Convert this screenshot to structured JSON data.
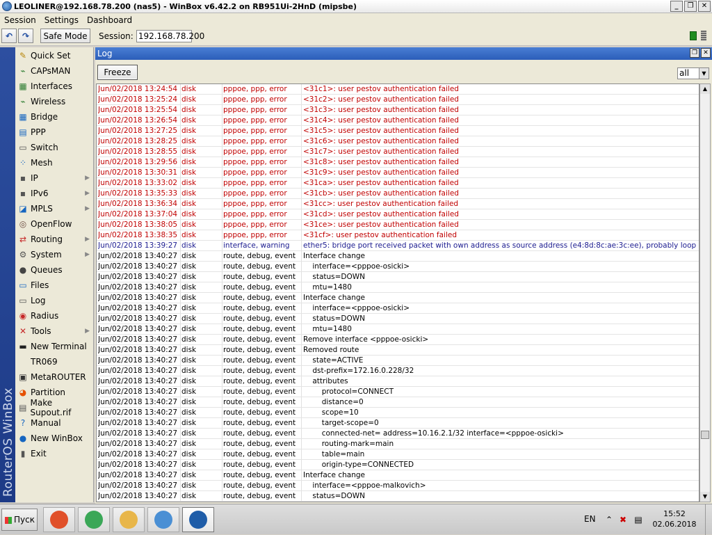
{
  "window": {
    "title": "LEOLINER@192.168.78.200 (nas5) - WinBox v6.42.2 on RB951Ui-2HnD (mipsbe)",
    "minimize": "_",
    "maximize": "❐",
    "close": "✕"
  },
  "menu": {
    "items": [
      "Session",
      "Settings",
      "Dashboard"
    ]
  },
  "toolbar": {
    "undo": "↶",
    "redo": "↷",
    "safe_mode": "Safe Mode",
    "session_label": "Session:",
    "session_value": "192.168.78.200"
  },
  "brand": "RouterOS WinBox",
  "sidebar": {
    "items": [
      {
        "label": "Quick Set",
        "icon": "quickset-icon",
        "glyph": "✎",
        "color": "#b8860b",
        "submenu": false
      },
      {
        "label": "CAPsMAN",
        "icon": "capsman-icon",
        "glyph": "⌁",
        "color": "#2e7d32",
        "submenu": false
      },
      {
        "label": "Interfaces",
        "icon": "interfaces-icon",
        "glyph": "▦",
        "color": "#2e7d32",
        "submenu": false
      },
      {
        "label": "Wireless",
        "icon": "wireless-icon",
        "glyph": "⌁",
        "color": "#2e7d32",
        "submenu": false
      },
      {
        "label": "Bridge",
        "icon": "bridge-icon",
        "glyph": "▦",
        "color": "#1565c0",
        "submenu": false
      },
      {
        "label": "PPP",
        "icon": "ppp-icon",
        "glyph": "▤",
        "color": "#1565c0",
        "submenu": false
      },
      {
        "label": "Switch",
        "icon": "switch-icon",
        "glyph": "▭",
        "color": "#555555",
        "submenu": false
      },
      {
        "label": "Mesh",
        "icon": "mesh-icon",
        "glyph": "⁘",
        "color": "#1565c0",
        "submenu": false
      },
      {
        "label": "IP",
        "icon": "ip-icon",
        "glyph": "▪",
        "color": "#555555",
        "submenu": true
      },
      {
        "label": "IPv6",
        "icon": "ipv6-icon",
        "glyph": "▪",
        "color": "#555555",
        "submenu": true
      },
      {
        "label": "MPLS",
        "icon": "mpls-icon",
        "glyph": "◪",
        "color": "#1565c0",
        "submenu": true
      },
      {
        "label": "OpenFlow",
        "icon": "openflow-icon",
        "glyph": "◎",
        "color": "#6d4c41",
        "submenu": false
      },
      {
        "label": "Routing",
        "icon": "routing-icon",
        "glyph": "⇄",
        "color": "#c62828",
        "submenu": true
      },
      {
        "label": "System",
        "icon": "system-icon",
        "glyph": "⚙",
        "color": "#555555",
        "submenu": true
      },
      {
        "label": "Queues",
        "icon": "queues-icon",
        "glyph": "●",
        "color": "#444444",
        "submenu": false
      },
      {
        "label": "Files",
        "icon": "files-icon",
        "glyph": "▭",
        "color": "#1565c0",
        "submenu": false
      },
      {
        "label": "Log",
        "icon": "log-icon",
        "glyph": "▭",
        "color": "#555555",
        "submenu": false
      },
      {
        "label": "Radius",
        "icon": "radius-icon",
        "glyph": "◉",
        "color": "#c62828",
        "submenu": false
      },
      {
        "label": "Tools",
        "icon": "tools-icon",
        "glyph": "✕",
        "color": "#c62828",
        "submenu": true
      },
      {
        "label": "New Terminal",
        "icon": "terminal-icon",
        "glyph": "▬",
        "color": "#222222",
        "submenu": false
      },
      {
        "label": "TR069",
        "icon": "",
        "glyph": "",
        "color": "#000000",
        "submenu": false
      },
      {
        "label": "MetaROUTER",
        "icon": "metarouter-icon",
        "glyph": "▣",
        "color": "#333333",
        "submenu": false
      },
      {
        "label": "Partition",
        "icon": "partition-icon",
        "glyph": "◕",
        "color": "#e65100",
        "submenu": false
      },
      {
        "label": "Make Supout.rif",
        "icon": "supout-icon",
        "glyph": "▤",
        "color": "#555555",
        "submenu": false
      },
      {
        "label": "Manual",
        "icon": "manual-icon",
        "glyph": "?",
        "color": "#1565c0",
        "submenu": false
      },
      {
        "label": "New WinBox",
        "icon": "winbox-icon",
        "glyph": "●",
        "color": "#1565c0",
        "submenu": false
      },
      {
        "label": "Exit",
        "icon": "exit-icon",
        "glyph": "▮",
        "color": "#555555",
        "submenu": false
      }
    ]
  },
  "log_window": {
    "title": "Log",
    "freeze_label": "Freeze",
    "filter_value": "all",
    "rows": [
      {
        "time": "Jun/02/2018 13:24:54",
        "buffer": "disk",
        "topics": "pppoe, ppp, error",
        "message": "<31c1>: user pestov authentication failed",
        "level": "error"
      },
      {
        "time": "Jun/02/2018 13:25:24",
        "buffer": "disk",
        "topics": "pppoe, ppp, error",
        "message": "<31c2>: user pestov authentication failed",
        "level": "error"
      },
      {
        "time": "Jun/02/2018 13:25:54",
        "buffer": "disk",
        "topics": "pppoe, ppp, error",
        "message": "<31c3>: user pestov authentication failed",
        "level": "error"
      },
      {
        "time": "Jun/02/2018 13:26:54",
        "buffer": "disk",
        "topics": "pppoe, ppp, error",
        "message": "<31c4>: user pestov authentication failed",
        "level": "error"
      },
      {
        "time": "Jun/02/2018 13:27:25",
        "buffer": "disk",
        "topics": "pppoe, ppp, error",
        "message": "<31c5>: user pestov authentication failed",
        "level": "error"
      },
      {
        "time": "Jun/02/2018 13:28:25",
        "buffer": "disk",
        "topics": "pppoe, ppp, error",
        "message": "<31c6>: user pestov authentication failed",
        "level": "error"
      },
      {
        "time": "Jun/02/2018 13:28:55",
        "buffer": "disk",
        "topics": "pppoe, ppp, error",
        "message": "<31c7>: user pestov authentication failed",
        "level": "error"
      },
      {
        "time": "Jun/02/2018 13:29:56",
        "buffer": "disk",
        "topics": "pppoe, ppp, error",
        "message": "<31c8>: user pestov authentication failed",
        "level": "error"
      },
      {
        "time": "Jun/02/2018 13:30:31",
        "buffer": "disk",
        "topics": "pppoe, ppp, error",
        "message": "<31c9>: user pestov authentication failed",
        "level": "error"
      },
      {
        "time": "Jun/02/2018 13:33:02",
        "buffer": "disk",
        "topics": "pppoe, ppp, error",
        "message": "<31ca>: user pestov authentication failed",
        "level": "error"
      },
      {
        "time": "Jun/02/2018 13:35:33",
        "buffer": "disk",
        "topics": "pppoe, ppp, error",
        "message": "<31cb>: user pestov authentication failed",
        "level": "error"
      },
      {
        "time": "Jun/02/2018 13:36:34",
        "buffer": "disk",
        "topics": "pppoe, ppp, error",
        "message": "<31cc>: user pestov authentication failed",
        "level": "error"
      },
      {
        "time": "Jun/02/2018 13:37:04",
        "buffer": "disk",
        "topics": "pppoe, ppp, error",
        "message": "<31cd>: user pestov authentication failed",
        "level": "error"
      },
      {
        "time": "Jun/02/2018 13:38:05",
        "buffer": "disk",
        "topics": "pppoe, ppp, error",
        "message": "<31ce>: user pestov authentication failed",
        "level": "error"
      },
      {
        "time": "Jun/02/2018 13:38:35",
        "buffer": "disk",
        "topics": "pppoe, ppp, error",
        "message": "<31cf>: user pestov authentication failed",
        "level": "error"
      },
      {
        "time": "Jun/02/2018 13:39:27",
        "buffer": "disk",
        "topics": "interface, warning",
        "message": "ether5: bridge port received packet with own address as source address (e4:8d:8c:ae:3c:ee), probably loop",
        "level": "warning"
      },
      {
        "time": "Jun/02/2018 13:40:27",
        "buffer": "disk",
        "topics": "route, debug, event",
        "message": "Interface change",
        "level": "event"
      },
      {
        "time": "Jun/02/2018 13:40:27",
        "buffer": "disk",
        "topics": "route, debug, event",
        "message": "    interface=<pppoe-osicki>",
        "level": "event"
      },
      {
        "time": "Jun/02/2018 13:40:27",
        "buffer": "disk",
        "topics": "route, debug, event",
        "message": "    status=DOWN",
        "level": "event"
      },
      {
        "time": "Jun/02/2018 13:40:27",
        "buffer": "disk",
        "topics": "route, debug, event",
        "message": "    mtu=1480",
        "level": "event"
      },
      {
        "time": "Jun/02/2018 13:40:27",
        "buffer": "disk",
        "topics": "route, debug, event",
        "message": "Interface change",
        "level": "event"
      },
      {
        "time": "Jun/02/2018 13:40:27",
        "buffer": "disk",
        "topics": "route, debug, event",
        "message": "    interface=<pppoe-osicki>",
        "level": "event"
      },
      {
        "time": "Jun/02/2018 13:40:27",
        "buffer": "disk",
        "topics": "route, debug, event",
        "message": "    status=DOWN",
        "level": "event"
      },
      {
        "time": "Jun/02/2018 13:40:27",
        "buffer": "disk",
        "topics": "route, debug, event",
        "message": "    mtu=1480",
        "level": "event"
      },
      {
        "time": "Jun/02/2018 13:40:27",
        "buffer": "disk",
        "topics": "route, debug, event",
        "message": "Remove interface <pppoe-osicki>",
        "level": "event"
      },
      {
        "time": "Jun/02/2018 13:40:27",
        "buffer": "disk",
        "topics": "route, debug, event",
        "message": "Removed route",
        "level": "event"
      },
      {
        "time": "Jun/02/2018 13:40:27",
        "buffer": "disk",
        "topics": "route, debug, event",
        "message": "    state=ACTIVE",
        "level": "event"
      },
      {
        "time": "Jun/02/2018 13:40:27",
        "buffer": "disk",
        "topics": "route, debug, event",
        "message": "    dst-prefix=172.16.0.228/32",
        "level": "event"
      },
      {
        "time": "Jun/02/2018 13:40:27",
        "buffer": "disk",
        "topics": "route, debug, event",
        "message": "    attributes",
        "level": "event"
      },
      {
        "time": "Jun/02/2018 13:40:27",
        "buffer": "disk",
        "topics": "route, debug, event",
        "message": "        protocol=CONNECT",
        "level": "event"
      },
      {
        "time": "Jun/02/2018 13:40:27",
        "buffer": "disk",
        "topics": "route, debug, event",
        "message": "        distance=0",
        "level": "event"
      },
      {
        "time": "Jun/02/2018 13:40:27",
        "buffer": "disk",
        "topics": "route, debug, event",
        "message": "        scope=10",
        "level": "event"
      },
      {
        "time": "Jun/02/2018 13:40:27",
        "buffer": "disk",
        "topics": "route, debug, event",
        "message": "        target-scope=0",
        "level": "event"
      },
      {
        "time": "Jun/02/2018 13:40:27",
        "buffer": "disk",
        "topics": "route, debug, event",
        "message": "        connected-net= address=10.16.2.1/32 interface=<pppoe-osicki>",
        "level": "event"
      },
      {
        "time": "Jun/02/2018 13:40:27",
        "buffer": "disk",
        "topics": "route, debug, event",
        "message": "        routing-mark=main",
        "level": "event"
      },
      {
        "time": "Jun/02/2018 13:40:27",
        "buffer": "disk",
        "topics": "route, debug, event",
        "message": "        table=main",
        "level": "event"
      },
      {
        "time": "Jun/02/2018 13:40:27",
        "buffer": "disk",
        "topics": "route, debug, event",
        "message": "        origin-type=CONNECTED",
        "level": "event"
      },
      {
        "time": "Jun/02/2018 13:40:27",
        "buffer": "disk",
        "topics": "route, debug, event",
        "message": "Interface change",
        "level": "event"
      },
      {
        "time": "Jun/02/2018 13:40:27",
        "buffer": "disk",
        "topics": "route, debug, event",
        "message": "    interface=<pppoe-malkovich>",
        "level": "event"
      },
      {
        "time": "Jun/02/2018 13:40:27",
        "buffer": "disk",
        "topics": "route, debug, event",
        "message": "    status=DOWN",
        "level": "event"
      }
    ]
  },
  "taskbar": {
    "start_label": "Пуск",
    "apps": [
      {
        "icon": "office-icon",
        "color": "#e0502a"
      },
      {
        "icon": "chrome-icon",
        "color": "#3aa757"
      },
      {
        "icon": "explorer-icon",
        "color": "#e8b64a"
      },
      {
        "icon": "control-panel-icon",
        "color": "#4a8fd4"
      },
      {
        "icon": "winbox-app-icon",
        "color": "#1f5da8"
      }
    ],
    "language": "EN",
    "time": "15:52",
    "date": "02.06.2018"
  },
  "colors": {
    "error_text": "#c00000",
    "warning_text": "#1c1c90",
    "log_titlebar": "#2b5db9"
  }
}
